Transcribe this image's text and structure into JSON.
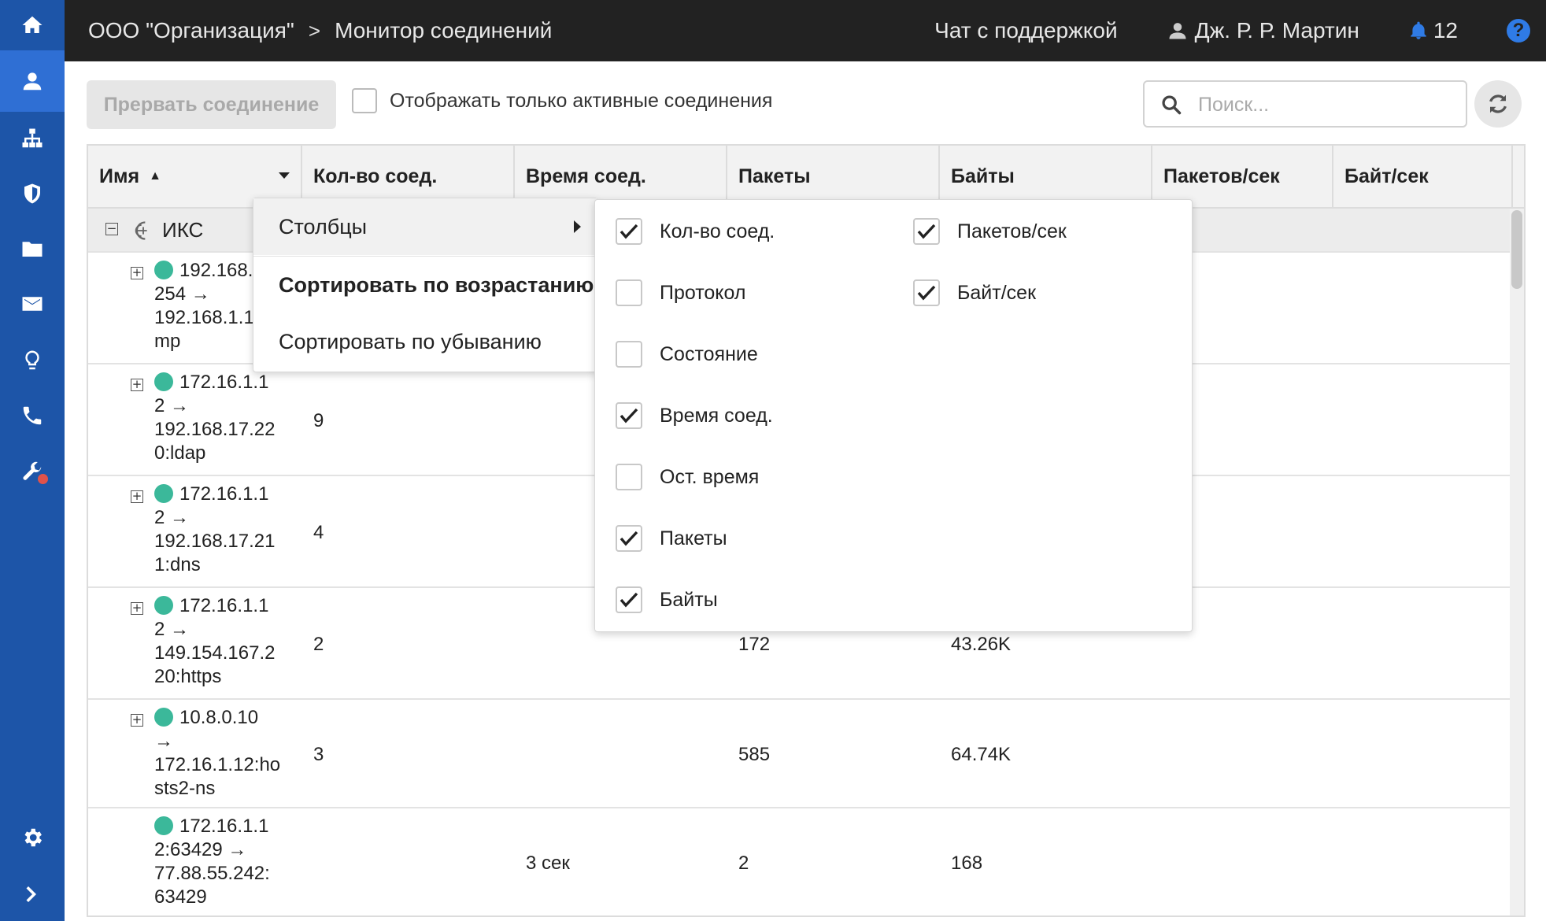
{
  "breadcrumb": {
    "org": "ООО \"Организация\"",
    "separator": ">",
    "page": "Монитор соединений"
  },
  "topbar": {
    "support": "Чат с поддержкой",
    "user": "Дж. Р. Р. Мартин",
    "notifications": "12",
    "help": "?"
  },
  "toolbar": {
    "abort_label": "Прервать соединение",
    "active_only_label": "Отображать только активные соединения",
    "search_placeholder": "Поиск..."
  },
  "columns": [
    "Имя",
    "Кол-во соед.",
    "Время соед.",
    "Пакеты",
    "Байты",
    "Пакетов/сек",
    "Байт/сек"
  ],
  "group": {
    "label": "ИКС"
  },
  "rows": [
    {
      "name": "192.168.1.254 → 192.168.1.1:icmp",
      "count": "",
      "time": "",
      "packets": "",
      "bytes": ""
    },
    {
      "name": "172.16.1.12 → 192.168.17.220:ldap",
      "count": "9",
      "time": "",
      "packets": "",
      "bytes": ""
    },
    {
      "name": "172.16.1.12 → 192.168.17.211:dns",
      "count": "4",
      "time": "",
      "packets": "",
      "bytes": ""
    },
    {
      "name": "172.16.1.12 → 149.154.167.220:https",
      "count": "2",
      "time": "",
      "packets": "172",
      "bytes": "43.26K"
    },
    {
      "name": "10.8.0.10 → 172.16.1.12:hosts2-ns",
      "count": "3",
      "time": "",
      "packets": "585",
      "bytes": "64.74K"
    },
    {
      "name": "172.16.1.12:63429 → 77.88.55.242:63429",
      "count": "",
      "time": "3 сек",
      "packets": "2",
      "bytes": "168"
    }
  ],
  "name_lines": [
    [
      "192.168.1.",
      "254 →",
      "192.168.1.1:ic",
      "mp"
    ],
    [
      "172.16.1.1",
      "2 →",
      "192.168.17.22",
      "0:ldap"
    ],
    [
      "172.16.1.1",
      "2 →",
      "192.168.17.21",
      "1:dns"
    ],
    [
      "172.16.1.1",
      "2 →",
      "149.154.167.2",
      "20:https"
    ],
    [
      "10.8.0.10",
      "→",
      "172.16.1.12:ho",
      "sts2-ns"
    ],
    [
      "172.16.1.1",
      "2:63429 →",
      "77.88.55.242:",
      "63429"
    ]
  ],
  "context_menu": {
    "columns": "Столбцы",
    "sort_asc": "Сортировать по возрастанию",
    "sort_desc": "Сортировать по убыванию"
  },
  "column_options": [
    {
      "label": "Кол-во соед.",
      "checked": true
    },
    {
      "label": "Протокол",
      "checked": false
    },
    {
      "label": "Состояние",
      "checked": false
    },
    {
      "label": "Время соед.",
      "checked": true
    },
    {
      "label": "Ост. время",
      "checked": false
    },
    {
      "label": "Пакеты",
      "checked": true
    },
    {
      "label": "Байты",
      "checked": true
    },
    {
      "label": "Пакетов/сек",
      "checked": true
    },
    {
      "label": "Байт/сек",
      "checked": true
    }
  ],
  "colors": {
    "sidebar": "#1d55a8",
    "sidebar_active": "#2f6fd4",
    "topbar": "#222222",
    "accent": "#2f7be6",
    "status_active": "#3bb89a",
    "alert": "#e0524a"
  }
}
